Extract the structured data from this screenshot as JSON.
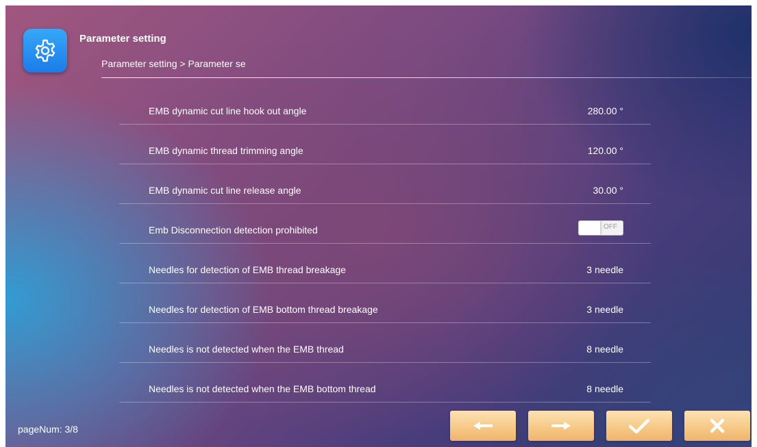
{
  "header": {
    "title": "Parameter setting",
    "breadcrumb": "Parameter setting > Parameter se",
    "icon": "gear-icon"
  },
  "parameters": [
    {
      "label": "EMB dynamic cut line hook out angle",
      "value": "280.00 °"
    },
    {
      "label": "EMB dynamic thread trimming angle",
      "value": "120.00 °"
    },
    {
      "label": "EMB dynamic cut line release angle",
      "value": "30.00 °"
    },
    {
      "label": "Emb Disconnection detection prohibited",
      "toggle": "OFF"
    },
    {
      "label": "Needles for detection of EMB thread breakage",
      "value": "3 needle"
    },
    {
      "label": "Needles for detection of EMB bottom thread breakage",
      "value": "3 needle"
    },
    {
      "label": "Needles is not detected when the EMB thread",
      "value": "8 needle"
    },
    {
      "label": "Needles is not detected when the EMB bottom thread",
      "value": "8 needle"
    }
  ],
  "footer": {
    "page_num": "pageNum: 3/8",
    "buttons": [
      "arrow-left-icon",
      "arrow-right-icon",
      "check-icon",
      "close-icon"
    ]
  },
  "colors": {
    "icon_bg": "#1d7be8",
    "button_bg": "#f6c988"
  }
}
